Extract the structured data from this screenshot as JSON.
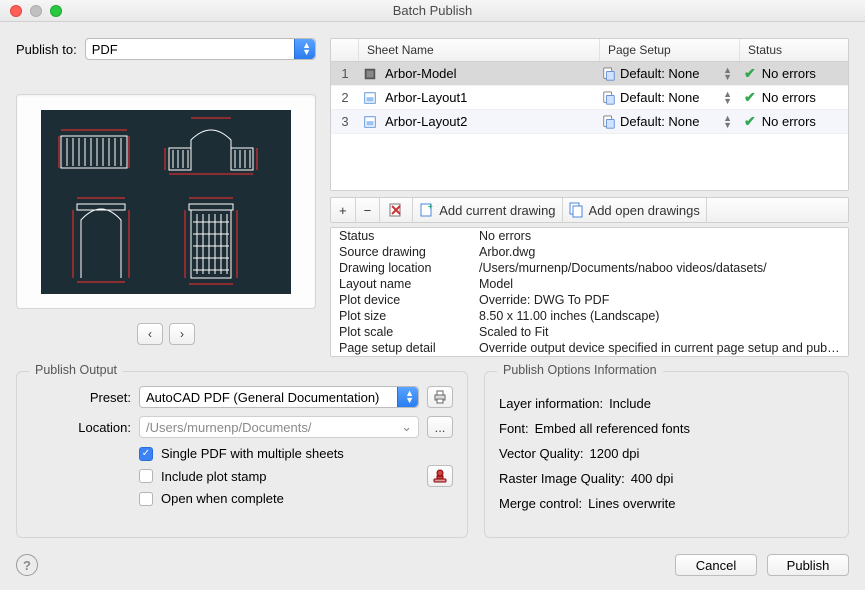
{
  "window": {
    "title": "Batch Publish"
  },
  "publish_to": {
    "label": "Publish to:",
    "value": "PDF"
  },
  "nav": {
    "prev": "‹",
    "next": "›"
  },
  "sheet_table": {
    "headers": {
      "name": "Sheet Name",
      "page": "Page Setup",
      "status": "Status"
    },
    "rows": [
      {
        "idx": "1",
        "name": "Arbor-Model",
        "page_setup": "Default: None",
        "status": "No errors",
        "icon": "model"
      },
      {
        "idx": "2",
        "name": "Arbor-Layout1",
        "page_setup": "Default: None",
        "status": "No errors",
        "icon": "layout"
      },
      {
        "idx": "3",
        "name": "Arbor-Layout2",
        "page_setup": "Default: None",
        "status": "No errors",
        "icon": "layout"
      }
    ]
  },
  "toolbar": {
    "add": "+",
    "remove": "−",
    "add_current": "Add current drawing",
    "add_open": "Add open drawings"
  },
  "details": {
    "Status": "No errors",
    "Source_drawing": "Arbor.dwg",
    "Drawing_location": "/Users/murnenp/Documents/naboo videos/datasets/",
    "Layout_name": "Model",
    "Plot_device": "Override: DWG To PDF",
    "Plot_size": "8.50 x 11.00 inches (Landscape)",
    "Plot_scale": "Scaled to Fit",
    "Page_setup_detail": "Override output device specified in current page setup and publis…"
  },
  "details_keys": {
    "Status": "Status",
    "Source_drawing": "Source drawing",
    "Drawing_location": "Drawing location",
    "Layout_name": "Layout name",
    "Plot_device": "Plot device",
    "Plot_size": "Plot size",
    "Plot_scale": "Plot scale",
    "Page_setup_detail": "Page setup detail"
  },
  "output": {
    "legend": "Publish Output",
    "preset_label": "Preset:",
    "preset_value": "AutoCAD PDF (General Documentation)",
    "location_label": "Location:",
    "location_value": "/Users/murnenp/Documents/",
    "single_pdf": "Single PDF with multiple sheets",
    "include_stamp": "Include plot stamp",
    "open_complete": "Open when complete",
    "browse": "...",
    "printer_icon": "⎙",
    "stamp_icon": "⛀"
  },
  "options_info": {
    "legend": "Publish Options Information",
    "layer_k": "Layer information:",
    "layer_v": "Include",
    "font_k": "Font:",
    "font_v": "Embed all referenced fonts",
    "vq_k": "Vector Quality:",
    "vq_v": "1200 dpi",
    "rq_k": "Raster Image Quality:",
    "rq_v": "400 dpi",
    "merge_k": "Merge control:",
    "merge_v": "Lines overwrite"
  },
  "footer": {
    "help": "?",
    "cancel": "Cancel",
    "publish": "Publish"
  }
}
